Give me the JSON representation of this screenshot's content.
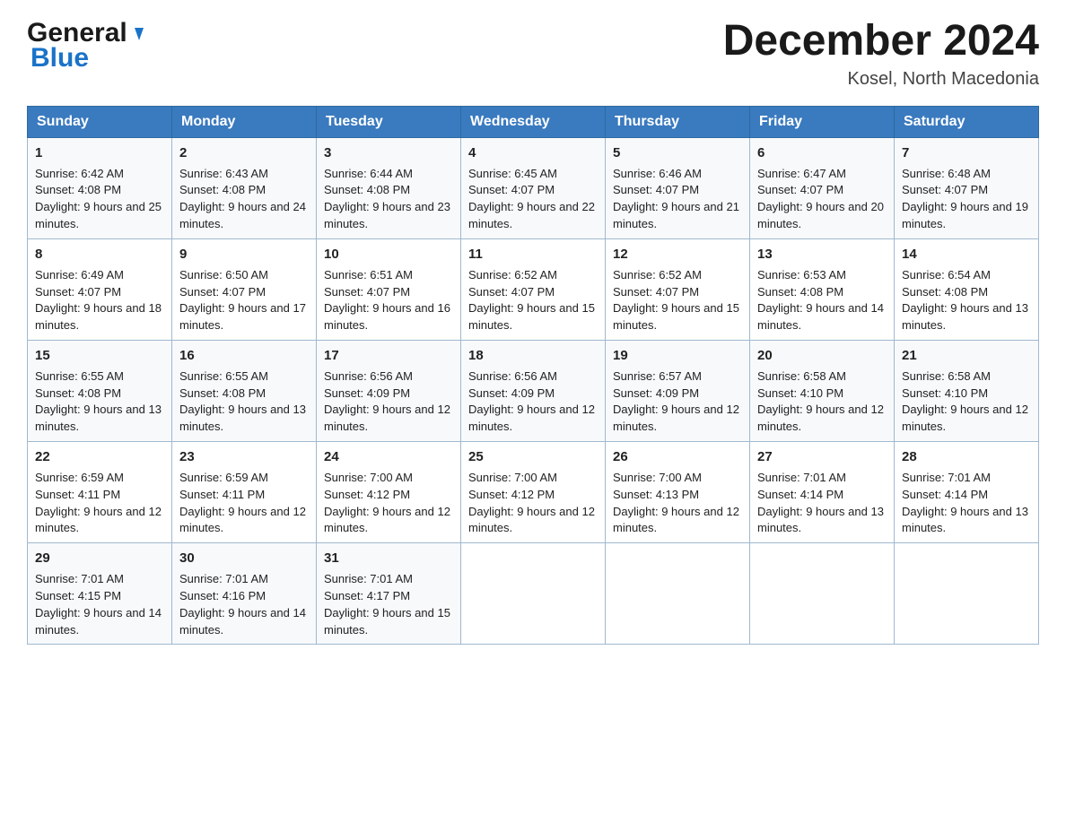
{
  "header": {
    "logo_general": "General",
    "logo_blue": "Blue",
    "title": "December 2024",
    "subtitle": "Kosel, North Macedonia"
  },
  "calendar": {
    "days_of_week": [
      "Sunday",
      "Monday",
      "Tuesday",
      "Wednesday",
      "Thursday",
      "Friday",
      "Saturday"
    ],
    "weeks": [
      [
        {
          "day": "1",
          "sunrise": "6:42 AM",
          "sunset": "4:08 PM",
          "daylight": "9 hours and 25 minutes."
        },
        {
          "day": "2",
          "sunrise": "6:43 AM",
          "sunset": "4:08 PM",
          "daylight": "9 hours and 24 minutes."
        },
        {
          "day": "3",
          "sunrise": "6:44 AM",
          "sunset": "4:08 PM",
          "daylight": "9 hours and 23 minutes."
        },
        {
          "day": "4",
          "sunrise": "6:45 AM",
          "sunset": "4:07 PM",
          "daylight": "9 hours and 22 minutes."
        },
        {
          "day": "5",
          "sunrise": "6:46 AM",
          "sunset": "4:07 PM",
          "daylight": "9 hours and 21 minutes."
        },
        {
          "day": "6",
          "sunrise": "6:47 AM",
          "sunset": "4:07 PM",
          "daylight": "9 hours and 20 minutes."
        },
        {
          "day": "7",
          "sunrise": "6:48 AM",
          "sunset": "4:07 PM",
          "daylight": "9 hours and 19 minutes."
        }
      ],
      [
        {
          "day": "8",
          "sunrise": "6:49 AM",
          "sunset": "4:07 PM",
          "daylight": "9 hours and 18 minutes."
        },
        {
          "day": "9",
          "sunrise": "6:50 AM",
          "sunset": "4:07 PM",
          "daylight": "9 hours and 17 minutes."
        },
        {
          "day": "10",
          "sunrise": "6:51 AM",
          "sunset": "4:07 PM",
          "daylight": "9 hours and 16 minutes."
        },
        {
          "day": "11",
          "sunrise": "6:52 AM",
          "sunset": "4:07 PM",
          "daylight": "9 hours and 15 minutes."
        },
        {
          "day": "12",
          "sunrise": "6:52 AM",
          "sunset": "4:07 PM",
          "daylight": "9 hours and 15 minutes."
        },
        {
          "day": "13",
          "sunrise": "6:53 AM",
          "sunset": "4:08 PM",
          "daylight": "9 hours and 14 minutes."
        },
        {
          "day": "14",
          "sunrise": "6:54 AM",
          "sunset": "4:08 PM",
          "daylight": "9 hours and 13 minutes."
        }
      ],
      [
        {
          "day": "15",
          "sunrise": "6:55 AM",
          "sunset": "4:08 PM",
          "daylight": "9 hours and 13 minutes."
        },
        {
          "day": "16",
          "sunrise": "6:55 AM",
          "sunset": "4:08 PM",
          "daylight": "9 hours and 13 minutes."
        },
        {
          "day": "17",
          "sunrise": "6:56 AM",
          "sunset": "4:09 PM",
          "daylight": "9 hours and 12 minutes."
        },
        {
          "day": "18",
          "sunrise": "6:56 AM",
          "sunset": "4:09 PM",
          "daylight": "9 hours and 12 minutes."
        },
        {
          "day": "19",
          "sunrise": "6:57 AM",
          "sunset": "4:09 PM",
          "daylight": "9 hours and 12 minutes."
        },
        {
          "day": "20",
          "sunrise": "6:58 AM",
          "sunset": "4:10 PM",
          "daylight": "9 hours and 12 minutes."
        },
        {
          "day": "21",
          "sunrise": "6:58 AM",
          "sunset": "4:10 PM",
          "daylight": "9 hours and 12 minutes."
        }
      ],
      [
        {
          "day": "22",
          "sunrise": "6:59 AM",
          "sunset": "4:11 PM",
          "daylight": "9 hours and 12 minutes."
        },
        {
          "day": "23",
          "sunrise": "6:59 AM",
          "sunset": "4:11 PM",
          "daylight": "9 hours and 12 minutes."
        },
        {
          "day": "24",
          "sunrise": "7:00 AM",
          "sunset": "4:12 PM",
          "daylight": "9 hours and 12 minutes."
        },
        {
          "day": "25",
          "sunrise": "7:00 AM",
          "sunset": "4:12 PM",
          "daylight": "9 hours and 12 minutes."
        },
        {
          "day": "26",
          "sunrise": "7:00 AM",
          "sunset": "4:13 PM",
          "daylight": "9 hours and 12 minutes."
        },
        {
          "day": "27",
          "sunrise": "7:01 AM",
          "sunset": "4:14 PM",
          "daylight": "9 hours and 13 minutes."
        },
        {
          "day": "28",
          "sunrise": "7:01 AM",
          "sunset": "4:14 PM",
          "daylight": "9 hours and 13 minutes."
        }
      ],
      [
        {
          "day": "29",
          "sunrise": "7:01 AM",
          "sunset": "4:15 PM",
          "daylight": "9 hours and 14 minutes."
        },
        {
          "day": "30",
          "sunrise": "7:01 AM",
          "sunset": "4:16 PM",
          "daylight": "9 hours and 14 minutes."
        },
        {
          "day": "31",
          "sunrise": "7:01 AM",
          "sunset": "4:17 PM",
          "daylight": "9 hours and 15 minutes."
        },
        null,
        null,
        null,
        null
      ]
    ]
  }
}
